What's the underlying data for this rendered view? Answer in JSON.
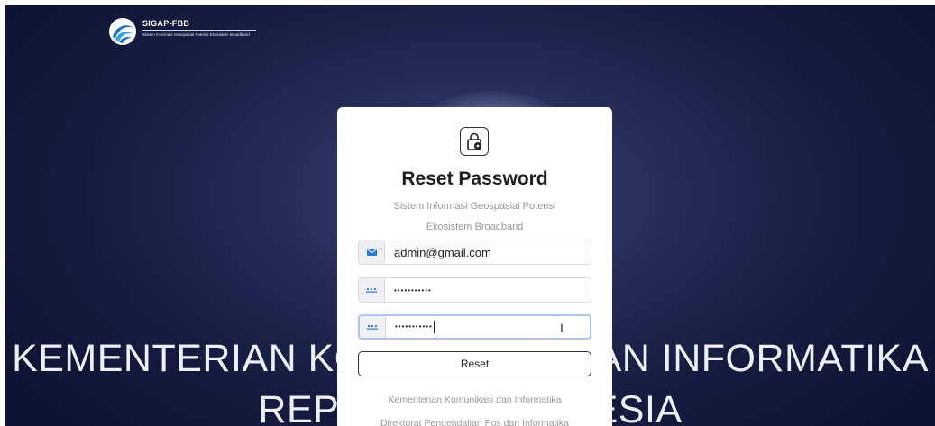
{
  "brand": {
    "title": "SIGAP-FBB",
    "subtitle": "Sistem Informasi Geospasial Potensi Ekosistem Broadband",
    "logo_icon": "swirl-logo-icon"
  },
  "background": {
    "line1": "KEMENTERIAN KOMUNIKASI DAN INFORMATIKA",
    "line2": "REPUBLIK INDONESIA"
  },
  "card": {
    "icon": "lock-icon",
    "title": "Reset Password",
    "subtitle": "Sistem Informasi Geospasial Potensi Ekosistem Broadband",
    "email": {
      "icon": "envelope-icon",
      "value": "admin@gmail.com"
    },
    "password": {
      "icon": "password-dots-icon",
      "value": "•••••••••••"
    },
    "confirm_password": {
      "icon": "password-dots-icon",
      "value": "•••••••••••"
    },
    "reset_label": "Reset",
    "footer_line1": "Kementerian Komunikasi dan Informatika",
    "footer_line2": "Direktorat Pengendalian Pos dan Informatika"
  },
  "colors": {
    "background_dark": "#151b3f",
    "addon_icon": "#2b7bdc",
    "focus_border": "#a9c5f0"
  }
}
